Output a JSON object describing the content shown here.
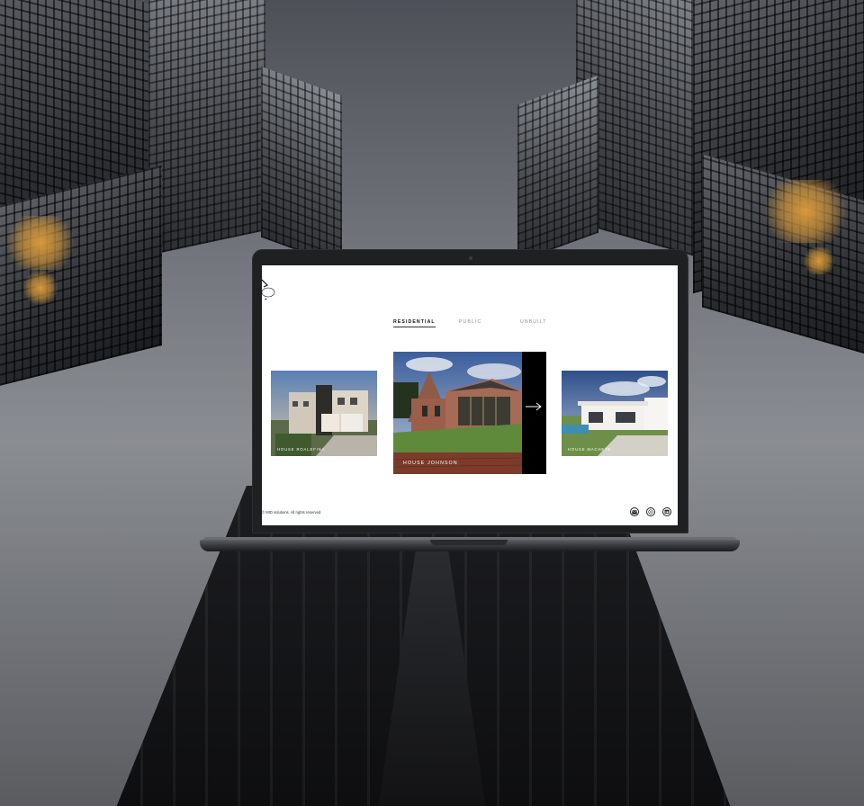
{
  "tabs": [
    {
      "label": "RESIDENTIAL",
      "active": true
    },
    {
      "label": "PUBLIC",
      "active": false
    },
    {
      "label": "UNBUILT",
      "active": false
    }
  ],
  "projects": [
    {
      "title": "HOUSE ROALEFINA"
    },
    {
      "title": "HOUSE JOHNSON"
    },
    {
      "title": "HOUSE MACHETE"
    }
  ],
  "footer": {
    "copyright": "© MID solutions. All rights reserved.",
    "social_icons": [
      "mail-icon",
      "whatsapp-icon",
      "linkedin-icon"
    ]
  },
  "icons": {
    "next": "arrow-right-icon",
    "logo": "logo-mark-icon"
  },
  "colors": {
    "screen_bg": "#ffffff",
    "text": "#111111",
    "accent_panel": "#000000"
  }
}
